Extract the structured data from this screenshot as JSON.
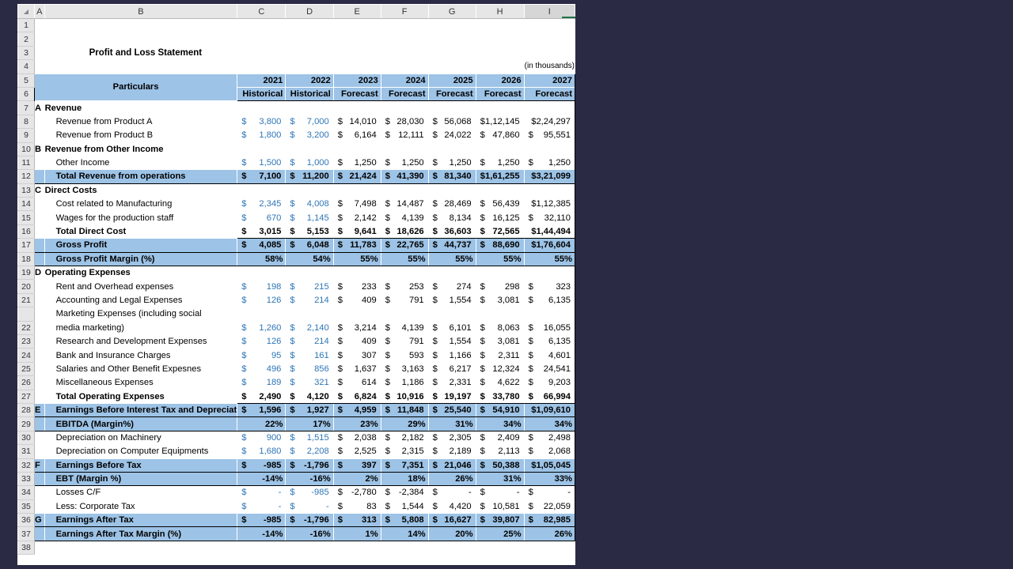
{
  "columns": [
    "A",
    "B",
    "C",
    "D",
    "E",
    "F",
    "G",
    "H",
    "I"
  ],
  "title": "Profit and Loss Statement",
  "units_note": "(in thousands)",
  "header": {
    "particulars": "Particulars",
    "years": [
      "2021",
      "2022",
      "2023",
      "2024",
      "2025",
      "2026",
      "2027"
    ],
    "types": [
      "Historical",
      "Historical",
      "Forecast",
      "Forecast",
      "Forecast",
      "Forecast",
      "Forecast"
    ]
  },
  "rows": [
    {
      "n": "7",
      "a": "A",
      "label": "Revenue",
      "style": "section"
    },
    {
      "n": "8",
      "label": "Revenue from Product A",
      "vals": [
        "3,800",
        "7,000",
        "14,010",
        "28,030",
        "56,068",
        "$1,12,145",
        "$2,24,297"
      ]
    },
    {
      "n": "9",
      "label": "Revenue from Product B",
      "vals": [
        "1,800",
        "3,200",
        "6,164",
        "12,111",
        "24,022",
        "47,860",
        "95,551"
      ]
    },
    {
      "n": "10",
      "a": "B",
      "label": "Revenue from Other Income",
      "style": "section"
    },
    {
      "n": "11",
      "label": "Other Income",
      "vals": [
        "1,500",
        "1,000",
        "1,250",
        "1,250",
        "1,250",
        "1,250",
        "1,250"
      ]
    },
    {
      "n": "12",
      "label": "Total Revenue from operations",
      "style": "total",
      "vals": [
        "7,100",
        "11,200",
        "21,424",
        "41,390",
        "81,340",
        "$1,61,255",
        "$3,21,099"
      ]
    },
    {
      "n": "13",
      "a": "C",
      "label": "Direct Costs",
      "style": "section"
    },
    {
      "n": "14",
      "label": "Cost related to Manufacturing",
      "vals": [
        "2,345",
        "4,008",
        "7,498",
        "14,487",
        "28,469",
        "56,439",
        "$1,12,385"
      ]
    },
    {
      "n": "15",
      "label": "Wages for the production staff",
      "vals": [
        "670",
        "1,145",
        "2,142",
        "4,139",
        "8,134",
        "16,125",
        "32,110"
      ]
    },
    {
      "n": "16",
      "label": "Total Direct Cost",
      "style": "subtotal",
      "vals": [
        "3,015",
        "5,153",
        "9,641",
        "18,626",
        "36,603",
        "72,565",
        "$1,44,494"
      ]
    },
    {
      "n": "17",
      "label": "Gross Profit",
      "style": "total",
      "vals": [
        "4,085",
        "6,048",
        "11,783",
        "22,765",
        "44,737",
        "88,690",
        "$1,76,604"
      ]
    },
    {
      "n": "18",
      "label": "Gross Profit Margin (%)",
      "style": "pct",
      "vals": [
        "58%",
        "54%",
        "55%",
        "55%",
        "55%",
        "55%",
        "55%"
      ]
    },
    {
      "n": "19",
      "a": "D",
      "label": "Operating Expenses",
      "style": "section"
    },
    {
      "n": "20",
      "label": "Rent and Overhead expenses",
      "vals": [
        "198",
        "215",
        "233",
        "253",
        "274",
        "298",
        "323"
      ]
    },
    {
      "n": "21",
      "label": "Accounting and Legal Expenses",
      "vals": [
        "126",
        "214",
        "409",
        "791",
        "1,554",
        "3,081",
        "6,135"
      ]
    },
    {
      "n": "",
      "label": "Marketing Expenses (including social",
      "style": "wrap"
    },
    {
      "n": "22",
      "label": "media marketing)",
      "vals": [
        "1,260",
        "2,140",
        "3,214",
        "4,139",
        "6,101",
        "8,063",
        "16,055"
      ]
    },
    {
      "n": "23",
      "label": "Research and Development Expenses",
      "vals": [
        "126",
        "214",
        "409",
        "791",
        "1,554",
        "3,081",
        "6,135"
      ]
    },
    {
      "n": "24",
      "label": "Bank and Insurance Charges",
      "vals": [
        "95",
        "161",
        "307",
        "593",
        "1,166",
        "2,311",
        "4,601"
      ]
    },
    {
      "n": "25",
      "label": "Salaries and Other Benefit Expesnes",
      "vals": [
        "496",
        "856",
        "1,637",
        "3,163",
        "6,217",
        "12,324",
        "24,541"
      ]
    },
    {
      "n": "26",
      "label": "Miscellaneous Expenses",
      "vals": [
        "189",
        "321",
        "614",
        "1,186",
        "2,331",
        "4,622",
        "9,203"
      ]
    },
    {
      "n": "27",
      "label": "Total Operating Expenses",
      "style": "subtotal",
      "vals": [
        "2,490",
        "4,120",
        "6,824",
        "10,916",
        "19,197",
        "33,780",
        "66,994"
      ]
    },
    {
      "n": "28",
      "a": "E",
      "label": "Earnings Before Interest Tax and Depreciat",
      "style": "total",
      "vals": [
        "1,596",
        "1,927",
        "4,959",
        "11,848",
        "25,540",
        "54,910",
        "$1,09,610"
      ]
    },
    {
      "n": "29",
      "label": "EBITDA (Margin%)",
      "style": "pct",
      "vals": [
        "22%",
        "17%",
        "23%",
        "29%",
        "31%",
        "34%",
        "34%"
      ]
    },
    {
      "n": "30",
      "label": "Depreciation on Machinery",
      "vals": [
        "900",
        "1,515",
        "2,038",
        "2,182",
        "2,305",
        "2,409",
        "2,498"
      ]
    },
    {
      "n": "31",
      "label": "Depreciation on Computer Equipments",
      "vals": [
        "1,680",
        "2,208",
        "2,525",
        "2,315",
        "2,189",
        "2,113",
        "2,068"
      ]
    },
    {
      "n": "32",
      "a": "F",
      "label": "Earnings Before Tax",
      "style": "total",
      "vals": [
        "-985",
        "-1,796",
        "397",
        "7,351",
        "21,046",
        "50,388",
        "$1,05,045"
      ]
    },
    {
      "n": "33",
      "label": "EBT (Margin %)",
      "style": "pct",
      "vals": [
        "-14%",
        "-16%",
        "2%",
        "18%",
        "26%",
        "31%",
        "33%"
      ]
    },
    {
      "n": "34",
      "label": "Losses C/F",
      "vals": [
        "-",
        "-985",
        "-2,780",
        "-2,384",
        "-",
        "-",
        "-"
      ]
    },
    {
      "n": "35",
      "label": "Less: Corporate Tax",
      "vals": [
        "-",
        "-",
        "83",
        "1,544",
        "4,420",
        "10,581",
        "22,059"
      ]
    },
    {
      "n": "36",
      "a": "G",
      "label": "Earnings After Tax",
      "style": "total",
      "vals": [
        "-985",
        "-1,796",
        "313",
        "5,808",
        "16,627",
        "39,807",
        "82,985"
      ]
    },
    {
      "n": "37",
      "label": "Earnings After Tax Margin (%)",
      "style": "pct",
      "vals": [
        "-14%",
        "-16%",
        "1%",
        "14%",
        "20%",
        "25%",
        "26%"
      ]
    },
    {
      "n": "38",
      "label": "",
      "style": "empty"
    }
  ],
  "currency": "$",
  "colors": {
    "header_fill": "#9dc3e6",
    "input_blue": "#2e75b6",
    "background": "#2b2a45"
  }
}
